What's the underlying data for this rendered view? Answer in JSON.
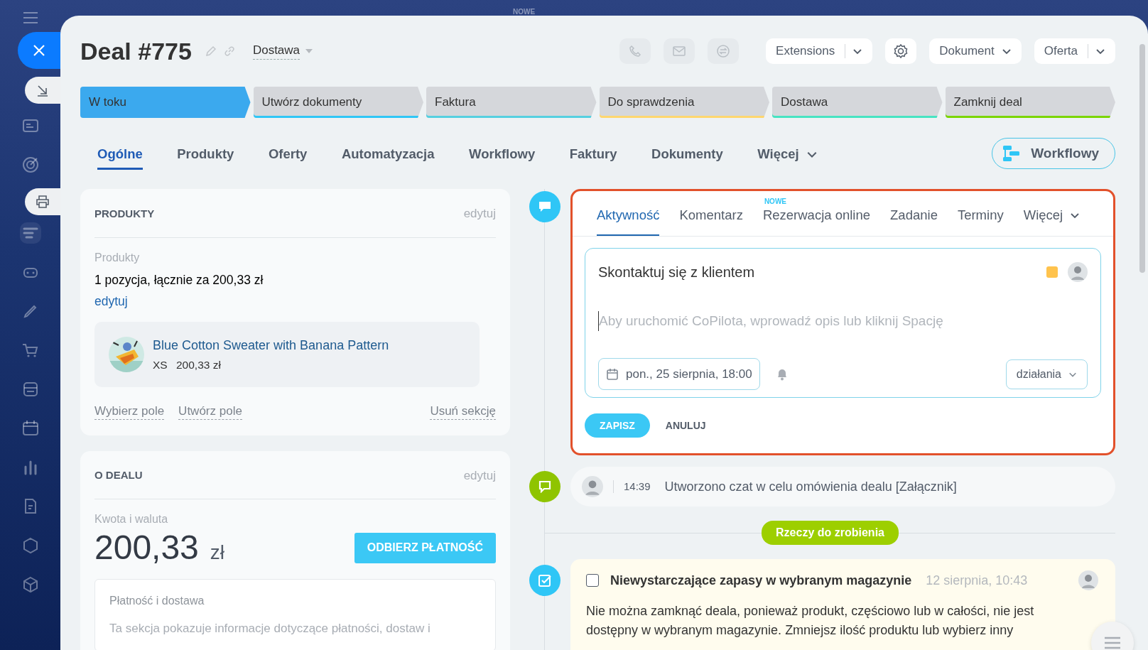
{
  "top_label": "NOWE",
  "header": {
    "title": "Deal #775",
    "pipeline": "Dostawa",
    "contact_buttons": [
      {
        "kind": "phone",
        "disabled": true
      },
      {
        "kind": "mail",
        "disabled": true
      },
      {
        "kind": "chat",
        "disabled": true
      }
    ],
    "toolbar": [
      {
        "kind": "split",
        "label": "Extensions"
      },
      {
        "kind": "settings"
      },
      {
        "kind": "dropdown",
        "label": "Dokument"
      },
      {
        "kind": "split",
        "label": "Oferta"
      }
    ]
  },
  "stages": [
    {
      "label": "W toku",
      "selected": true,
      "color": "#3ba9ee"
    },
    {
      "label": "Utwórz dokumenty",
      "selected": false,
      "color": "#2fc6f6"
    },
    {
      "label": "Faktura",
      "selected": false,
      "color": "#55d0e0"
    },
    {
      "label": "Do sprawdzenia",
      "selected": false,
      "color": "#ffd66e"
    },
    {
      "label": "Dostawa",
      "selected": false,
      "color": "#47e4c2"
    },
    {
      "label": "Zamknij deal",
      "selected": false,
      "color": "#7bd500"
    }
  ],
  "tabs": [
    {
      "label": "Ogólne",
      "selected": true,
      "kind": "tab"
    },
    {
      "label": "Produkty",
      "selected": false,
      "kind": "tab"
    },
    {
      "label": "Oferty",
      "selected": false,
      "kind": "tab"
    },
    {
      "label": "Automatyzacja",
      "selected": false,
      "kind": "tab"
    },
    {
      "label": "Workflowy",
      "selected": false,
      "kind": "tab"
    },
    {
      "label": "Faktury",
      "selected": false,
      "kind": "tab"
    },
    {
      "label": "Dokumenty",
      "selected": false,
      "kind": "tab"
    },
    {
      "label": "Więcej",
      "selected": false,
      "kind": "more"
    }
  ],
  "workflow_button": "Workflowy",
  "products_card": {
    "title": "PRODUKTY",
    "edit": "edytuj",
    "field_label": "Produkty",
    "summary": "1 pozycja, łącznie za 200,33 zł",
    "edit_link": "edytuj",
    "product": {
      "name": "Blue Cotton Sweater with Banana Pattern",
      "variant": "XS",
      "price": "200,33 zł"
    },
    "actions": [
      "Wybierz pole",
      "Utwórz pole"
    ],
    "remove": "Usuń sekcję"
  },
  "deal_card": {
    "title": "O DEALU",
    "edit": "edytuj",
    "amount_label": "Kwota i waluta",
    "amount": "200,33",
    "currency": "zł",
    "pay_button": "ODBIERZ PŁATNOŚĆ",
    "payment": {
      "title": "Płatność i dostawa",
      "text": "Ta sekcja pokazuje informacje dotyczące płatności, dostaw i"
    }
  },
  "activity_editor": {
    "tabs": [
      {
        "label": "Aktywność",
        "selected": true,
        "kind": "tab"
      },
      {
        "label": "Komentarz",
        "selected": false,
        "kind": "tab"
      },
      {
        "label": "Rezerwacja online",
        "selected": false,
        "kind": "tab",
        "badge": "NOWE"
      },
      {
        "label": "Zadanie",
        "selected": false,
        "kind": "tab"
      },
      {
        "label": "Terminy",
        "selected": false,
        "kind": "tab"
      },
      {
        "label": "Więcej",
        "selected": false,
        "kind": "more"
      }
    ],
    "title": "Skontaktuj się z klientem",
    "color": "#ffc34d",
    "placeholder": "Aby uruchomić CoPilota, wprowadź opis lub kliknij Spację",
    "deadline": "pon., 25 sierpnia, 18:00",
    "actions": "działania",
    "save": "ZAPISZ",
    "cancel": "ANULUJ"
  },
  "timeline": [
    {
      "kind": "chat",
      "time": "14:39",
      "text": "Utworzono czat w celu omówienia dealu [Załącznik]"
    }
  ],
  "todo_divider": "Rzeczy do zrobienia",
  "todo": {
    "checked": false,
    "title": "Niewystarczające zapasy w wybranym magazynie",
    "date": "12 sierpnia, 10:43",
    "text": "Nie można zamknąć deala, ponieważ produkt, częściowo lub w całości, nie jest dostępny w wybranym magazynie. Zmniejsz ilość produktu lub wybierz inny"
  }
}
